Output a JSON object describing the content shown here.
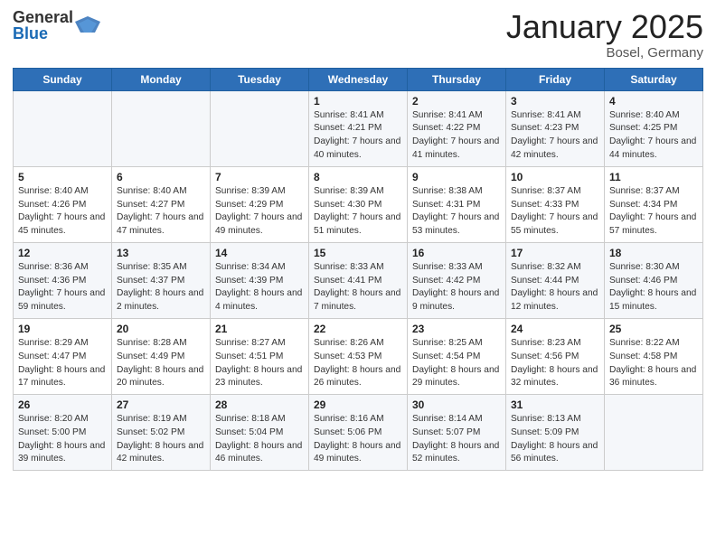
{
  "logo": {
    "general": "General",
    "blue": "Blue"
  },
  "title": "January 2025",
  "subtitle": "Bosel, Germany",
  "days_of_week": [
    "Sunday",
    "Monday",
    "Tuesday",
    "Wednesday",
    "Thursday",
    "Friday",
    "Saturday"
  ],
  "weeks": [
    [
      {
        "day": "",
        "info": ""
      },
      {
        "day": "",
        "info": ""
      },
      {
        "day": "",
        "info": ""
      },
      {
        "day": "1",
        "info": "Sunrise: 8:41 AM\nSunset: 4:21 PM\nDaylight: 7 hours\nand 40 minutes."
      },
      {
        "day": "2",
        "info": "Sunrise: 8:41 AM\nSunset: 4:22 PM\nDaylight: 7 hours\nand 41 minutes."
      },
      {
        "day": "3",
        "info": "Sunrise: 8:41 AM\nSunset: 4:23 PM\nDaylight: 7 hours\nand 42 minutes."
      },
      {
        "day": "4",
        "info": "Sunrise: 8:40 AM\nSunset: 4:25 PM\nDaylight: 7 hours\nand 44 minutes."
      }
    ],
    [
      {
        "day": "5",
        "info": "Sunrise: 8:40 AM\nSunset: 4:26 PM\nDaylight: 7 hours\nand 45 minutes."
      },
      {
        "day": "6",
        "info": "Sunrise: 8:40 AM\nSunset: 4:27 PM\nDaylight: 7 hours\nand 47 minutes."
      },
      {
        "day": "7",
        "info": "Sunrise: 8:39 AM\nSunset: 4:29 PM\nDaylight: 7 hours\nand 49 minutes."
      },
      {
        "day": "8",
        "info": "Sunrise: 8:39 AM\nSunset: 4:30 PM\nDaylight: 7 hours\nand 51 minutes."
      },
      {
        "day": "9",
        "info": "Sunrise: 8:38 AM\nSunset: 4:31 PM\nDaylight: 7 hours\nand 53 minutes."
      },
      {
        "day": "10",
        "info": "Sunrise: 8:37 AM\nSunset: 4:33 PM\nDaylight: 7 hours\nand 55 minutes."
      },
      {
        "day": "11",
        "info": "Sunrise: 8:37 AM\nSunset: 4:34 PM\nDaylight: 7 hours\nand 57 minutes."
      }
    ],
    [
      {
        "day": "12",
        "info": "Sunrise: 8:36 AM\nSunset: 4:36 PM\nDaylight: 7 hours\nand 59 minutes."
      },
      {
        "day": "13",
        "info": "Sunrise: 8:35 AM\nSunset: 4:37 PM\nDaylight: 8 hours\nand 2 minutes."
      },
      {
        "day": "14",
        "info": "Sunrise: 8:34 AM\nSunset: 4:39 PM\nDaylight: 8 hours\nand 4 minutes."
      },
      {
        "day": "15",
        "info": "Sunrise: 8:33 AM\nSunset: 4:41 PM\nDaylight: 8 hours\nand 7 minutes."
      },
      {
        "day": "16",
        "info": "Sunrise: 8:33 AM\nSunset: 4:42 PM\nDaylight: 8 hours\nand 9 minutes."
      },
      {
        "day": "17",
        "info": "Sunrise: 8:32 AM\nSunset: 4:44 PM\nDaylight: 8 hours\nand 12 minutes."
      },
      {
        "day": "18",
        "info": "Sunrise: 8:30 AM\nSunset: 4:46 PM\nDaylight: 8 hours\nand 15 minutes."
      }
    ],
    [
      {
        "day": "19",
        "info": "Sunrise: 8:29 AM\nSunset: 4:47 PM\nDaylight: 8 hours\nand 17 minutes."
      },
      {
        "day": "20",
        "info": "Sunrise: 8:28 AM\nSunset: 4:49 PM\nDaylight: 8 hours\nand 20 minutes."
      },
      {
        "day": "21",
        "info": "Sunrise: 8:27 AM\nSunset: 4:51 PM\nDaylight: 8 hours\nand 23 minutes."
      },
      {
        "day": "22",
        "info": "Sunrise: 8:26 AM\nSunset: 4:53 PM\nDaylight: 8 hours\nand 26 minutes."
      },
      {
        "day": "23",
        "info": "Sunrise: 8:25 AM\nSunset: 4:54 PM\nDaylight: 8 hours\nand 29 minutes."
      },
      {
        "day": "24",
        "info": "Sunrise: 8:23 AM\nSunset: 4:56 PM\nDaylight: 8 hours\nand 32 minutes."
      },
      {
        "day": "25",
        "info": "Sunrise: 8:22 AM\nSunset: 4:58 PM\nDaylight: 8 hours\nand 36 minutes."
      }
    ],
    [
      {
        "day": "26",
        "info": "Sunrise: 8:20 AM\nSunset: 5:00 PM\nDaylight: 8 hours\nand 39 minutes."
      },
      {
        "day": "27",
        "info": "Sunrise: 8:19 AM\nSunset: 5:02 PM\nDaylight: 8 hours\nand 42 minutes."
      },
      {
        "day": "28",
        "info": "Sunrise: 8:18 AM\nSunset: 5:04 PM\nDaylight: 8 hours\nand 46 minutes."
      },
      {
        "day": "29",
        "info": "Sunrise: 8:16 AM\nSunset: 5:06 PM\nDaylight: 8 hours\nand 49 minutes."
      },
      {
        "day": "30",
        "info": "Sunrise: 8:14 AM\nSunset: 5:07 PM\nDaylight: 8 hours\nand 52 minutes."
      },
      {
        "day": "31",
        "info": "Sunrise: 8:13 AM\nSunset: 5:09 PM\nDaylight: 8 hours\nand 56 minutes."
      },
      {
        "day": "",
        "info": ""
      }
    ]
  ]
}
